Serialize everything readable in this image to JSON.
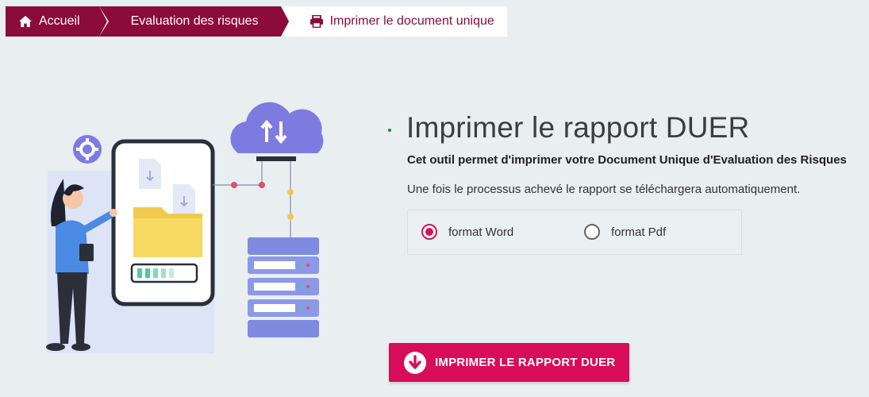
{
  "breadcrumb": {
    "home": "Accueil",
    "evaluation": "Evaluation des risques",
    "current": "Imprimer le document unique"
  },
  "main": {
    "title": "Imprimer le rapport DUER",
    "subtitle": "Cet outil permet d'imprimer votre Document Unique d'Evaluation des Risques",
    "info": "Une fois le processus achevé le rapport se téléchargera automatiquement."
  },
  "format": {
    "selected": "word",
    "options": [
      {
        "id": "word",
        "label": "format Word"
      },
      {
        "id": "pdf",
        "label": "format Pdf"
      }
    ]
  },
  "button": {
    "label": "IMPRIMER LE RAPPORT DUER"
  },
  "colors": {
    "brand": "#8b0b3a",
    "accent": "#d80c58"
  },
  "icons": [
    "home-icon",
    "printer-icon",
    "download-arrow-icon",
    "gear-icon",
    "cloud-upload-download-icon",
    "server-icon",
    "folder-icon",
    "file-download-icon"
  ]
}
